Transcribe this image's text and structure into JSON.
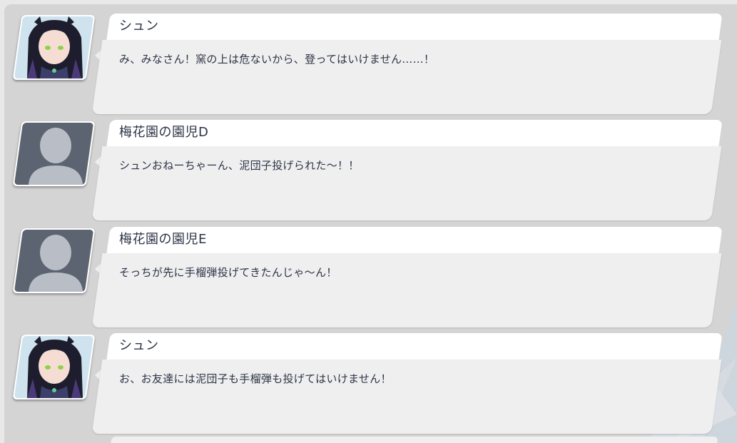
{
  "dialogue_log": {
    "entries": [
      {
        "speaker": "シュン",
        "text": "み、みなさん！窯の上は危ないから、登ってはいけません……！",
        "avatar": "shun-portrait"
      },
      {
        "speaker": "梅花園の園児D",
        "text": "シュンおねーちゃーん、泥団子投げられた〜！！",
        "avatar": "silhouette-placeholder"
      },
      {
        "speaker": "梅花園の園児E",
        "text": "そっちが先に手榴弾投げてきたんじゃ〜ん！",
        "avatar": "silhouette-placeholder"
      },
      {
        "speaker": "シュン",
        "text": "お、お友達には泥団子も手榴弾も投げてはいけません！",
        "avatar": "shun-portrait"
      }
    ]
  },
  "colors": {
    "window_bg": "#d4d4d4",
    "name_bar": "#ffffff",
    "body_bar": "#efefef",
    "text": "#2c3446",
    "silhouette_bg": "#5b6470",
    "silhouette_fg": "#b9bec6"
  }
}
